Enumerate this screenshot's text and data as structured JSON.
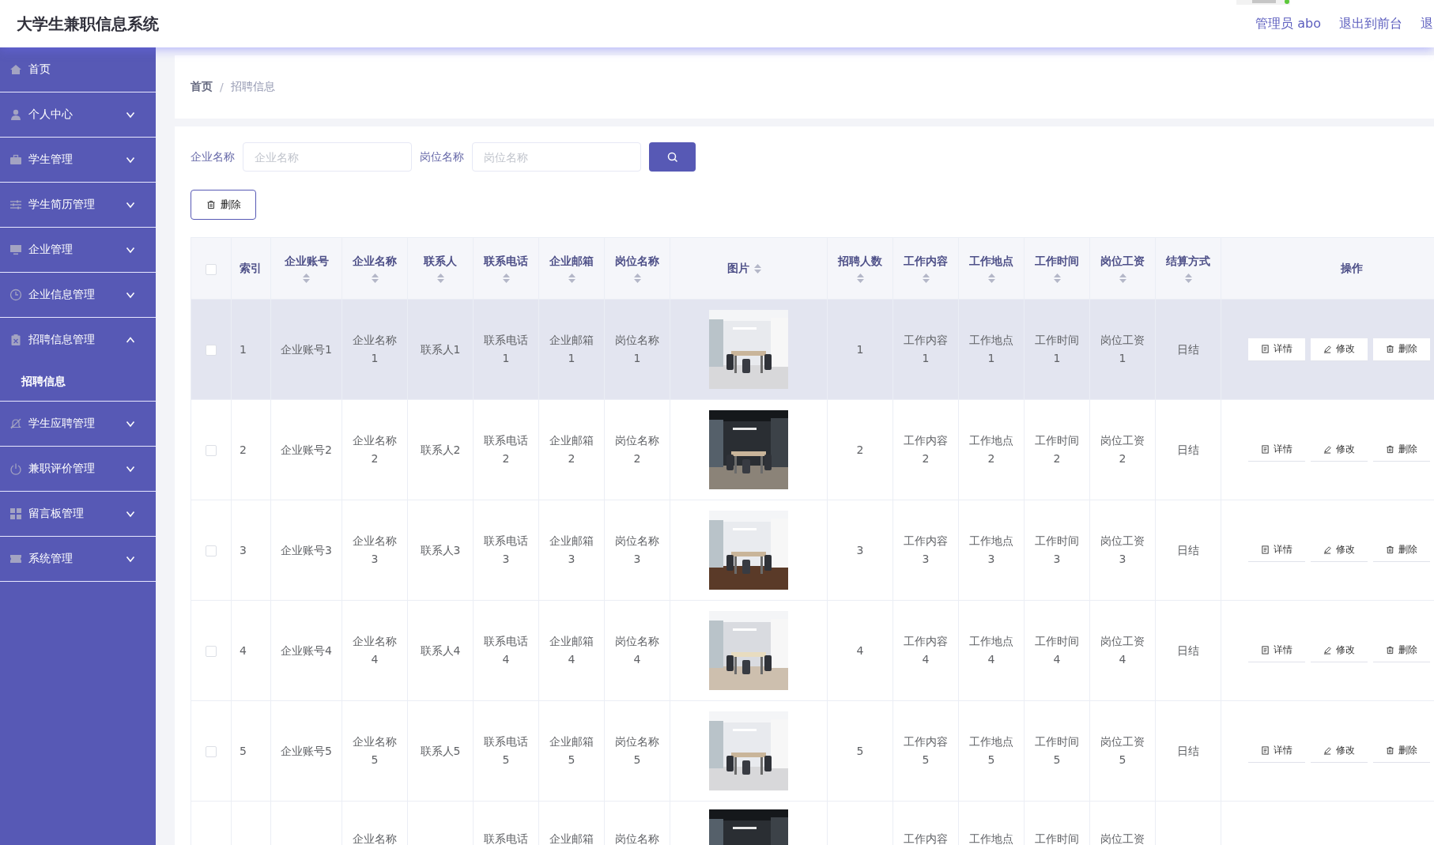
{
  "header": {
    "title": "大学生兼职信息系统",
    "links": [
      "管理员 abo",
      "退出到前台",
      "退"
    ]
  },
  "sidebar": {
    "items": [
      {
        "label": "首页"
      },
      {
        "label": "个人中心",
        "expanded": false
      },
      {
        "label": "学生管理",
        "expanded": false
      },
      {
        "label": "学生简历管理",
        "expanded": false
      },
      {
        "label": "企业管理",
        "expanded": false
      },
      {
        "label": "企业信息管理",
        "expanded": false
      },
      {
        "label": "招聘信息管理",
        "expanded": true,
        "children": [
          {
            "label": "招聘信息",
            "selected": true
          }
        ]
      },
      {
        "label": "学生应聘管理",
        "expanded": false
      },
      {
        "label": "兼职评价管理",
        "expanded": false
      },
      {
        "label": "留言板管理",
        "expanded": false
      },
      {
        "label": "系统管理",
        "expanded": false
      }
    ]
  },
  "breadcrumb": {
    "items": [
      "首页",
      "招聘信息"
    ],
    "separator": "/"
  },
  "search": {
    "fields": [
      {
        "label": "企业名称",
        "placeholder": "企业名称"
      },
      {
        "label": "岗位名称",
        "placeholder": "岗位名称"
      }
    ]
  },
  "delete_button": "删除",
  "table": {
    "select_all": {
      "checked": false
    },
    "columns": [
      {
        "label": "索引",
        "sortable": false
      },
      {
        "label": "企业账号",
        "sortable": true
      },
      {
        "label": "企业名称",
        "sortable": true
      },
      {
        "label": "联系人",
        "sortable": true
      },
      {
        "label": "联系电话",
        "sortable": true
      },
      {
        "label": "企业邮箱",
        "sortable": true
      },
      {
        "label": "岗位名称",
        "sortable": true
      },
      {
        "label": "图片",
        "sortable": true
      },
      {
        "label": "招聘人数",
        "sortable": true
      },
      {
        "label": "工作内容",
        "sortable": true
      },
      {
        "label": "工作地点",
        "sortable": true
      },
      {
        "label": "工作时间",
        "sortable": true
      },
      {
        "label": "岗位工资",
        "sortable": true
      },
      {
        "label": "结算方式",
        "sortable": true
      },
      {
        "label": "操作",
        "sortable": false
      }
    ],
    "rows": [
      {
        "checked": false,
        "highlighted": true,
        "index": "1",
        "account": "企业账号1",
        "company": "企业名称1",
        "contact": "联系人1",
        "phone": "联系电话1",
        "email": "企业邮箱1",
        "position": "岗位名称1",
        "headcount": "1",
        "content": "工作内容1",
        "location": "工作地点1",
        "time": "工作时间1",
        "salary": "岗位工资1",
        "settlement": "日结",
        "actions": [
          "详情",
          "修改",
          "删除"
        ]
      },
      {
        "checked": false,
        "highlighted": false,
        "index": "2",
        "account": "企业账号2",
        "company": "企业名称2",
        "contact": "联系人2",
        "phone": "联系电话2",
        "email": "企业邮箱2",
        "position": "岗位名称2",
        "headcount": "2",
        "content": "工作内容2",
        "location": "工作地点2",
        "time": "工作时间2",
        "salary": "岗位工资2",
        "settlement": "日结",
        "actions": [
          "详情",
          "修改",
          "删除"
        ]
      },
      {
        "checked": false,
        "highlighted": false,
        "index": "3",
        "account": "企业账号3",
        "company": "企业名称3",
        "contact": "联系人3",
        "phone": "联系电话3",
        "email": "企业邮箱3",
        "position": "岗位名称3",
        "headcount": "3",
        "content": "工作内容3",
        "location": "工作地点3",
        "time": "工作时间3",
        "salary": "岗位工资3",
        "settlement": "日结",
        "actions": [
          "详情",
          "修改",
          "删除"
        ]
      },
      {
        "checked": false,
        "highlighted": false,
        "index": "4",
        "account": "企业账号4",
        "company": "企业名称4",
        "contact": "联系人4",
        "phone": "联系电话4",
        "email": "企业邮箱4",
        "position": "岗位名称4",
        "headcount": "4",
        "content": "工作内容4",
        "location": "工作地点4",
        "time": "工作时间4",
        "salary": "岗位工资4",
        "settlement": "日结",
        "actions": [
          "详情",
          "修改",
          "删除"
        ]
      },
      {
        "checked": false,
        "highlighted": false,
        "index": "5",
        "account": "企业账号5",
        "company": "企业名称5",
        "contact": "联系人5",
        "phone": "联系电话5",
        "email": "企业邮箱5",
        "position": "岗位名称5",
        "headcount": "5",
        "content": "工作内容5",
        "location": "工作地点5",
        "time": "工作时间5",
        "salary": "岗位工资5",
        "settlement": "日结",
        "actions": [
          "详情",
          "修改",
          "删除"
        ]
      },
      {
        "highlighted": false,
        "company": "企业名称",
        "phone": "联系电话",
        "email": "企业邮箱",
        "position": "岗位名称",
        "content": "工作内容",
        "location": "工作地点",
        "time": "工作时间",
        "salary": "岗位工资"
      }
    ]
  }
}
